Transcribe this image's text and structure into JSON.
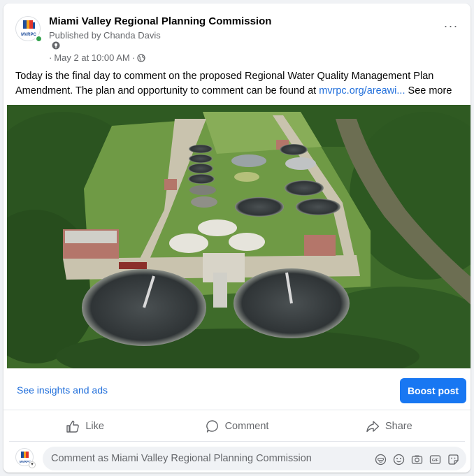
{
  "post": {
    "page_name": "Miami Valley Regional Planning Commission",
    "published_by": "Published by Chanda Davis",
    "date": "May 2 at 10:00 AM",
    "dot_prefix": "·",
    "dot_sep": "·",
    "body_text": "Today is the final day to comment on the proposed Regional Water Quality Management Plan Amendment. The plan and opportunity to comment can be found at ",
    "link_text": "mvrpc.org/areawi...",
    "see_more": " See more",
    "avatar_text": "MVRPC",
    "more_label": "···"
  },
  "insights": {
    "link_label": "See insights and ads",
    "boost_label": "Boost post"
  },
  "actions": {
    "like_label": "Like",
    "comment_label": "Comment",
    "share_label": "Share"
  },
  "composer": {
    "placeholder": "Comment as Miami Valley Regional Planning Commission",
    "icons": [
      "avatar-sticker-icon",
      "emoji-icon",
      "camera-icon",
      "gif-icon",
      "sticker-icon"
    ]
  },
  "colors": {
    "accent": "#1877f2",
    "link": "#216fdb",
    "secondary_text": "#65676b",
    "online": "#31a24c"
  }
}
